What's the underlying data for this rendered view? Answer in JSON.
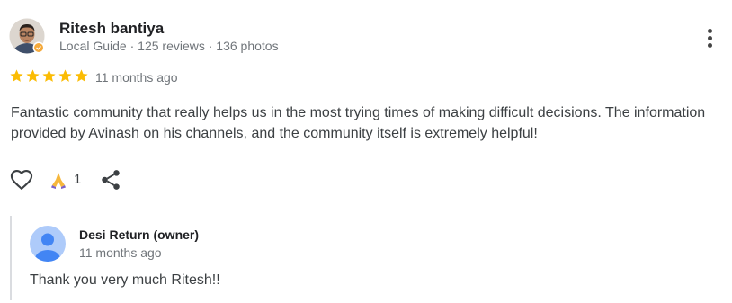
{
  "review": {
    "author_name": "Ritesh bantiya",
    "author_meta": "Local Guide · 125 reviews · 136 photos",
    "rating": 5,
    "rating_max": 5,
    "time": "11 months ago",
    "text": "Fantastic community that really helps us in the most trying times of making difficult decisions. The information provided by Avinash on his channels, and the community itself is extremely helpful!",
    "reaction_count": "1",
    "icons": {
      "more": "more-vert-icon",
      "like": "heart-outline-icon",
      "reaction": "praying-hands-emoji",
      "share": "share-icon",
      "badge": "local-guide-badge-icon"
    },
    "colors": {
      "star": "#fbbc04",
      "meta": "#70757a"
    }
  },
  "reply": {
    "author_name": "Desi Return (owner)",
    "time": "11 months ago",
    "text": "Thank you very much Ritesh!!",
    "colors": {
      "avatar_bg": "#aecbfa",
      "avatar_fg": "#4285f4"
    }
  }
}
